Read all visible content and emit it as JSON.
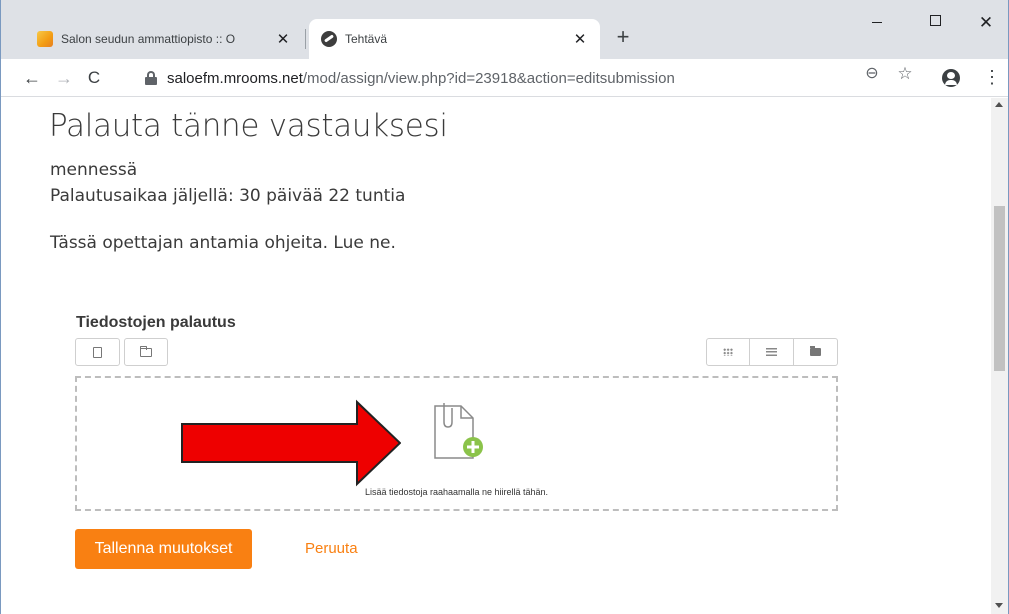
{
  "browser": {
    "tabs": [
      {
        "title": "Salon seudun ammattiopisto :: O",
        "close_label": "✕"
      },
      {
        "title": "Tehtävä",
        "close_label": "✕"
      }
    ],
    "new_tab_label": "+",
    "window_controls": {
      "close_label": "✕"
    },
    "address_bar": {
      "host": "saloefm.mrooms.net",
      "path": "/mod/assign/view.php?id=23918&action=editsubmission"
    },
    "icons": {
      "back": "←",
      "forward": "→",
      "reload": "C",
      "zoom": "⊖",
      "star": "☆",
      "menu": "⋮"
    }
  },
  "page": {
    "title": "Palauta tänne vastauksesi",
    "due_label": "mennessä",
    "time_remaining": "Palautusaikaa jäljellä: 30 päivää 22 tuntia",
    "instructions": "Tässä opettajan antamia ohjeita. Lue ne."
  },
  "file_manager": {
    "label": "Tiedostojen palautus",
    "dropzone_text": "Lisää tiedostoja raahaamalla ne hiirellä tähän."
  },
  "actions": {
    "save_label": "Tallenna muutokset",
    "cancel_label": "Peruuta"
  },
  "colors": {
    "accent": "#f98012",
    "arrow": "#ee0000",
    "add_badge": "#8bc34a"
  }
}
